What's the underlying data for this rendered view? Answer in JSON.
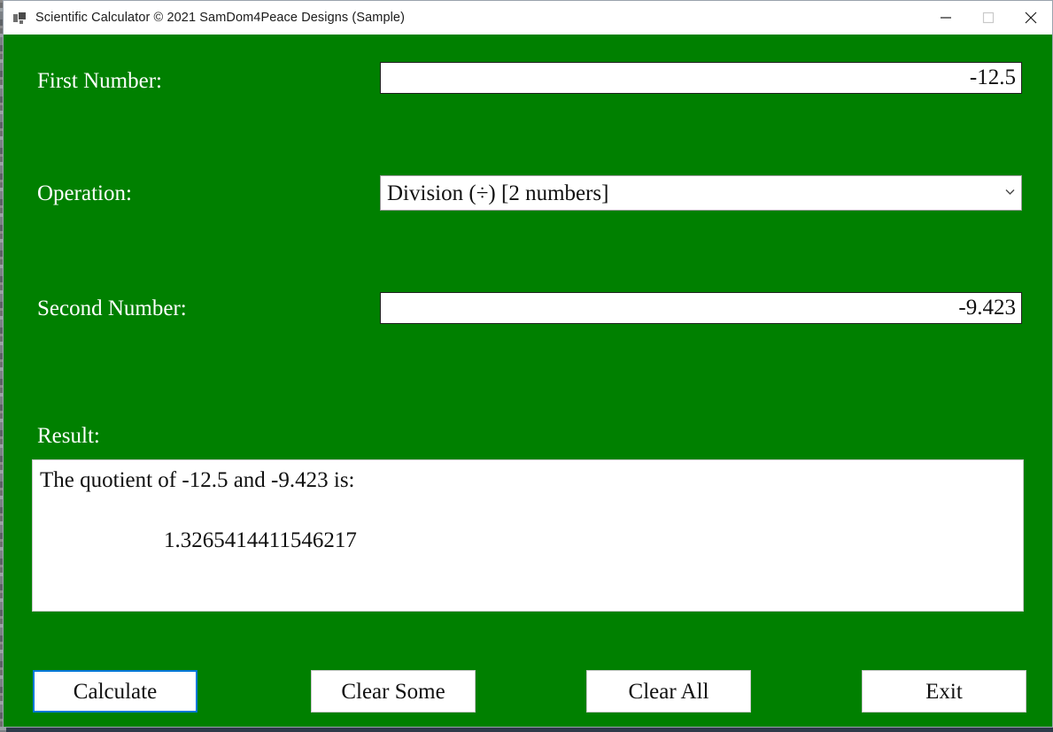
{
  "window": {
    "title": "Scientific Calculator © 2021 SamDom4Peace Designs (Sample)",
    "app_icon": "app-window-icon",
    "background_color": "#008000",
    "controls": {
      "minimize": "minimize-icon",
      "maximize": "maximize-icon",
      "close": "close-icon"
    }
  },
  "form": {
    "first_number": {
      "label": "First Number:",
      "value": "-12.5",
      "placeholder": ""
    },
    "operation": {
      "label": "Operation:",
      "value": "Division (÷) [2 numbers]",
      "chevron": "chevron-down-icon",
      "options": [
        "Division (÷) [2 numbers]"
      ]
    },
    "second_number": {
      "label": "Second Number:",
      "value": "-9.423",
      "placeholder": ""
    },
    "result": {
      "label": "Result:",
      "line1": "The quotient of -12.5 and -9.423 is:",
      "line2": "1.3265414411546217"
    }
  },
  "buttons": {
    "calculate": "Calculate",
    "clear_some": "Clear Some",
    "clear_all": "Clear All",
    "exit": "Exit",
    "focus_color": "#0078d7"
  }
}
